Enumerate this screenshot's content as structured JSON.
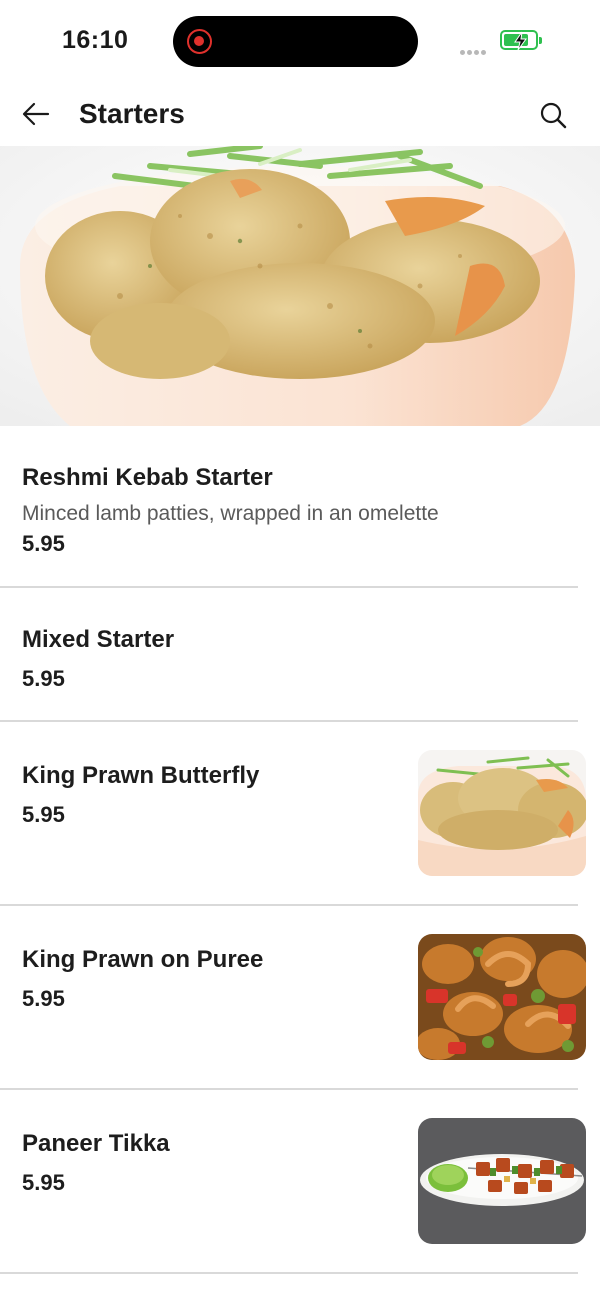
{
  "status_bar": {
    "time": "16:10",
    "battery_level": 0.8,
    "battery_color": "#2fc04f",
    "recording_color": "#e0312c"
  },
  "header": {
    "title": "Starters",
    "back_icon": "arrow-left-icon",
    "search_icon": "search-icon"
  },
  "menu": {
    "items": [
      {
        "name": "Reshmi Kebab Starter",
        "description": "Minced lamb patties, wrapped in an omelette",
        "price": "5.95",
        "image": null
      },
      {
        "name": "Mixed Starter",
        "description": "",
        "price": "5.95",
        "image": null
      },
      {
        "name": "King Prawn Butterfly",
        "description": "",
        "price": "5.95",
        "image": "breaded-prawns-photo"
      },
      {
        "name": "King Prawn on Puree",
        "description": "",
        "price": "5.95",
        "image": "prawn-curry-photo"
      },
      {
        "name": "Paneer Tikka",
        "description": "",
        "price": "5.95",
        "image": "paneer-skewers-photo"
      }
    ]
  }
}
